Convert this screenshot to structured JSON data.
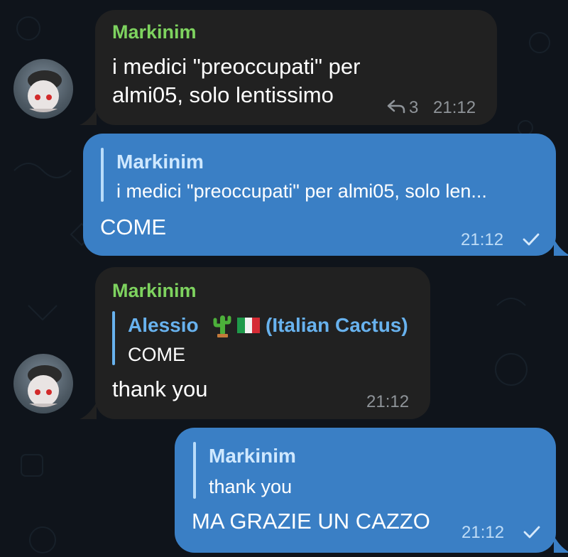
{
  "colors": {
    "background": "#0f141b",
    "incoming_bubble": "#212121",
    "outgoing_bubble": "#3a7fc5",
    "sender_name": "#7ed35f",
    "quote_name_incoming": "#68b2ee"
  },
  "messages": [
    {
      "direction": "incoming",
      "sender": "Markinim",
      "text_lines": [
        "i medici \"preoccupati\" per",
        "almi05, solo lentissimo"
      ],
      "reply_count": "3",
      "time": "21:12"
    },
    {
      "direction": "outgoing",
      "quote": {
        "name": "Markinim",
        "text": "i medici \"preoccupati\" per almi05, solo len..."
      },
      "text": "COME",
      "time": "21:12",
      "status_icon": "check-icon"
    },
    {
      "direction": "incoming",
      "sender": "Markinim",
      "quote": {
        "name": "Alessio",
        "name_suffix": "(Italian Cactus)",
        "text": "COME"
      },
      "text": "thank you",
      "time": "21:12"
    },
    {
      "direction": "outgoing",
      "quote": {
        "name": "Markinim",
        "text": "thank you"
      },
      "text": "MA GRAZIE UN CAZZO",
      "time": "21:12",
      "status_icon": "check-icon"
    }
  ]
}
